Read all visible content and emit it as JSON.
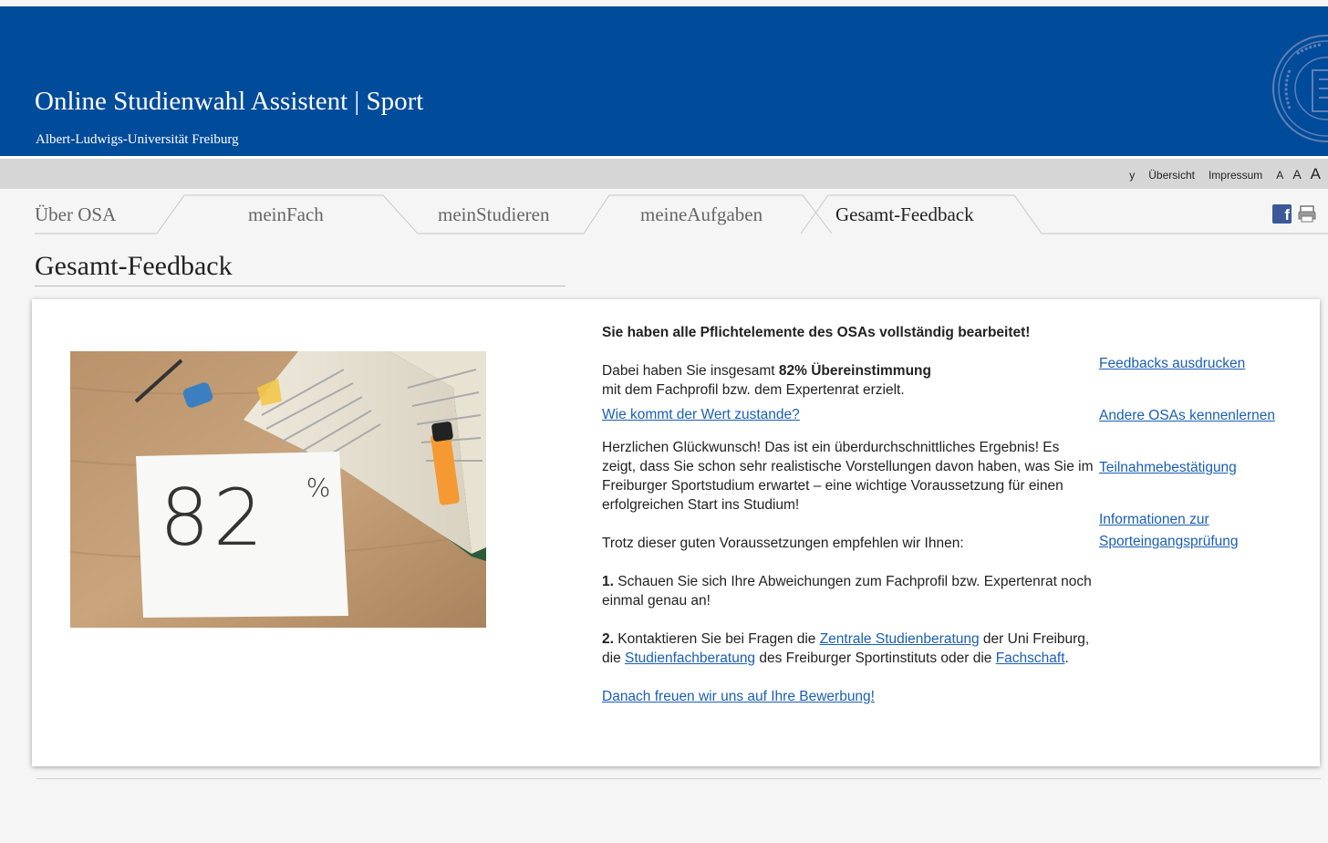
{
  "header": {
    "title": "Online Studienwahl Assistent | Sport",
    "subtitle": "Albert-Ludwigs-Universität Freiburg",
    "bg_color": "#004b9a"
  },
  "utility": {
    "partial_label": "y",
    "overview": "Übersicht",
    "imprint": "Impressum",
    "font_small": "A",
    "font_medium": "A",
    "font_large": "A"
  },
  "tabs": [
    {
      "label": "Über OSA",
      "active": false
    },
    {
      "label": "meinFach",
      "active": false
    },
    {
      "label": "meinStudieren",
      "active": false
    },
    {
      "label": "meineAufgaben",
      "active": false
    },
    {
      "label": "Gesamt-Feedback",
      "active": true
    }
  ],
  "social": {
    "facebook_icon": "facebook-icon",
    "facebook_glyph": "f",
    "print_icon": "print-icon"
  },
  "page_title": "Gesamt-Feedback",
  "image": {
    "handwritten_number": "82",
    "handwritten_percent": "%"
  },
  "content": {
    "lead": "Sie haben alle Pflichtelemente des OSAs vollständig bearbeitet!",
    "score_pre": "Dabei haben Sie insgesamt ",
    "score_bold": "82% Übereinstimmung",
    "score_post": "mit dem Fachprofil bzw. dem Expertenrat erzielt.",
    "score_link": "Wie kommt der Wert zustande?",
    "congrats": "Herzlichen Glückwunsch! Das ist ein überdurchschnittliches Ergebnis! Es zeigt, dass Sie schon sehr realistische Vorstellungen davon haben, was Sie im Freiburger Sportstudium erwartet – eine wichtige Voraussetzung für einen erfolgreichen Start ins Studium!",
    "recommend": "Trotz dieser guten Voraussetzungen empfehlen wir Ihnen:",
    "step1_num": "1.",
    "step1_text": " Schauen Sie sich Ihre Abweichungen zum Fachprofil bzw. Expertenrat noch einmal genau an!",
    "step2_num": "2.",
    "step2_pre": " Kontaktieren Sie bei Fragen die ",
    "step2_link1": "Zentrale Studienberatung",
    "step2_mid1": " der Uni Freiburg, die ",
    "step2_link2": "Studienfachberatung",
    "step2_mid2": " des Freiburger Sportinstituts oder die ",
    "step2_link3": "Fachschaft",
    "step2_end": ".",
    "closing_link": "Danach freuen wir uns auf Ihre Bewerbung!"
  },
  "side_links": [
    "Feedbacks ausdrucken",
    "Andere OSAs kennenlernen",
    "Teilnahmebestätigung",
    "Informationen zur Sporteingangsprüfung"
  ],
  "colors": {
    "link": "#1a5fb4",
    "utility_bar": "#d6d6d6",
    "page_bg": "#f5f5f5"
  }
}
